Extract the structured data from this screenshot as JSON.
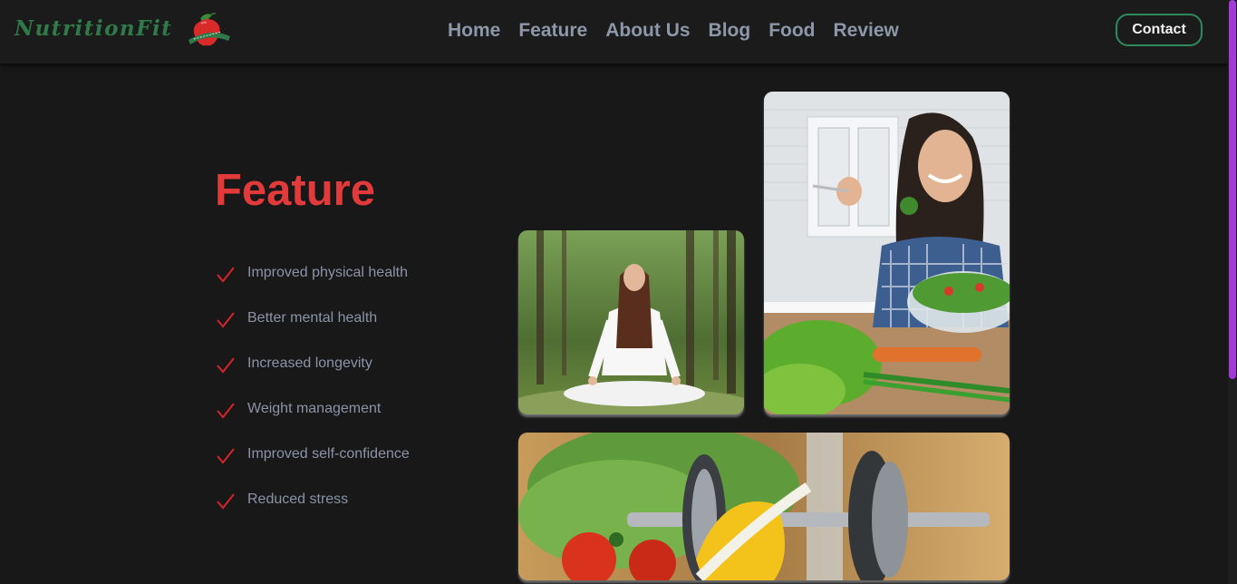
{
  "brand": {
    "name": "NutritionFit"
  },
  "nav": {
    "items": [
      "Home",
      "Feature",
      "About Us",
      "Blog",
      "Food",
      "Review"
    ],
    "contact_label": "Contact"
  },
  "feature": {
    "title": "Feature",
    "items": [
      "Improved physical health",
      "Better mental health",
      "Increased longevity",
      "Weight management",
      "Improved self-confidence",
      "Reduced stress"
    ]
  },
  "images": {
    "meditation": "woman-meditating-in-forest-photo",
    "healthy_eating": "woman-eating-salad-in-kitchen-photo",
    "fitness": "vegetables-and-dumbbells-photo"
  },
  "colors": {
    "background": "#181818",
    "navbar": "#1b1b1b",
    "accent_red": "#e23a3a",
    "brand_green": "#2f7a48",
    "contact_border": "#2e8a5c",
    "nav_text": "#8d97a8",
    "scrollbar": "#a23bd6"
  }
}
